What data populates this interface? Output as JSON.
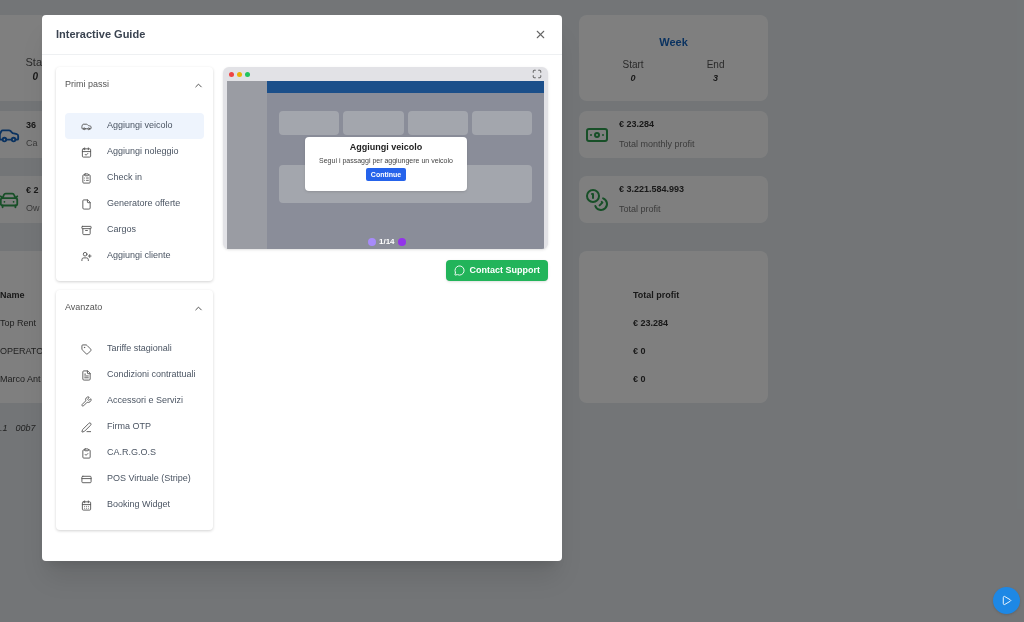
{
  "background": {
    "period_fragment": {
      "label": "Sta",
      "value": "0"
    },
    "week_card": {
      "title": "Week",
      "start_label": "Start",
      "start_value": "0",
      "end_label": "End",
      "end_value": "3"
    },
    "summary_rows": [
      {
        "left_value": "36",
        "left_label": "Ca",
        "right_value": "€ 23.284",
        "right_label": "Total monthly profit"
      },
      {
        "left_value": "€ 2",
        "left_label": "Ow",
        "right_value": "€ 3.221.584.993",
        "right_label": "Total profit"
      }
    ],
    "table": {
      "left_header": "Name",
      "right_header": "Total profit",
      "rows": [
        {
          "name": "Top Rent",
          "total_profit": "€ 23.284"
        },
        {
          "name": "OPERATO",
          "total_profit": "€ 0"
        },
        {
          "name": "Marco Ant",
          "total_profit": "€ 0"
        }
      ]
    },
    "footer_fragments": [
      ".1",
      "00b7"
    ]
  },
  "modal": {
    "title": "Interactive Guide",
    "sections": [
      {
        "title": "Primi passi",
        "expanded": true,
        "items": [
          {
            "kind": "car",
            "label": "Aggiungi veicolo",
            "selected": true
          },
          {
            "kind": "calendar-check",
            "label": "Aggiungi noleggio",
            "selected": false
          },
          {
            "kind": "list",
            "label": "Check in",
            "selected": false
          },
          {
            "kind": "file",
            "label": "Generatore offerte",
            "selected": false
          },
          {
            "kind": "archive",
            "label": "Cargos",
            "selected": false
          },
          {
            "kind": "user-plus",
            "label": "Aggiungi cliente",
            "selected": false
          }
        ]
      },
      {
        "title": "Avanzato",
        "expanded": true,
        "items": [
          {
            "kind": "tag",
            "label": "Tariffe stagionali",
            "selected": false
          },
          {
            "kind": "file-text",
            "label": "Condizioni contrattuali",
            "selected": false
          },
          {
            "kind": "wrench",
            "label": "Accessori e Servizi",
            "selected": false
          },
          {
            "kind": "pen",
            "label": "Firma OTP",
            "selected": false
          },
          {
            "kind": "clipboard-check",
            "label": "CA.R.G.O.S",
            "selected": false
          },
          {
            "kind": "credit-card",
            "label": "POS Virtuale (Stripe)",
            "selected": false
          },
          {
            "kind": "calendar",
            "label": "Booking Widget",
            "selected": false
          }
        ]
      }
    ],
    "preview": {
      "dialog_title": "Aggiungi veicolo",
      "dialog_text": "Segui i passaggi per aggiungere un veicolo",
      "dialog_button": "Continue",
      "step": "1/14"
    },
    "support_button": "Contact Support"
  }
}
